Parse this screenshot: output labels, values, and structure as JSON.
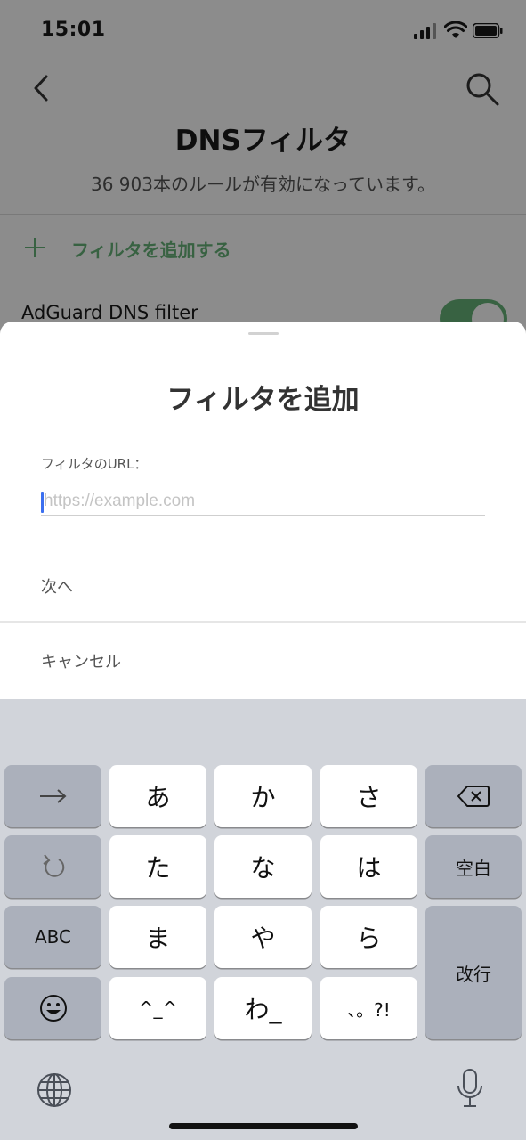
{
  "status_bar": {
    "time": "15:01"
  },
  "header": {
    "title": "DNSフィルタ",
    "subtitle": "36 903本のルールが有効になっています。",
    "back_icon": "chevron-left-icon",
    "search_icon": "search-icon"
  },
  "add_filter": {
    "label": "フィルタを追加する",
    "icon": "plus-icon"
  },
  "filters": [
    {
      "name": "AdGuard DNS filter",
      "enabled": true
    }
  ],
  "colors": {
    "accent": "#67b279",
    "caret": "#3b6ff0",
    "keyboard_bg": "#d1d4da"
  },
  "sheet": {
    "title": "フィルタを追加",
    "url_label": "フィルタのURL：",
    "url_value": "",
    "url_placeholder": "https://example.com",
    "next_label": "次へ",
    "cancel_label": "キャンセル"
  },
  "keyboard": {
    "keys": {
      "a": "あ",
      "ka": "か",
      "sa": "さ",
      "ta": "た",
      "na": "な",
      "ha": "は",
      "ma": "ま",
      "ya": "や",
      "ra": "ら",
      "emoticon": "^_^",
      "wa": "わ_",
      "punct": "、。?!",
      "abc": "ABC",
      "space": "空白",
      "return": "改行"
    },
    "icons": [
      "arrow-right-icon",
      "undo-icon",
      "backspace-icon",
      "emoji-icon",
      "globe-icon",
      "microphone-icon"
    ]
  }
}
